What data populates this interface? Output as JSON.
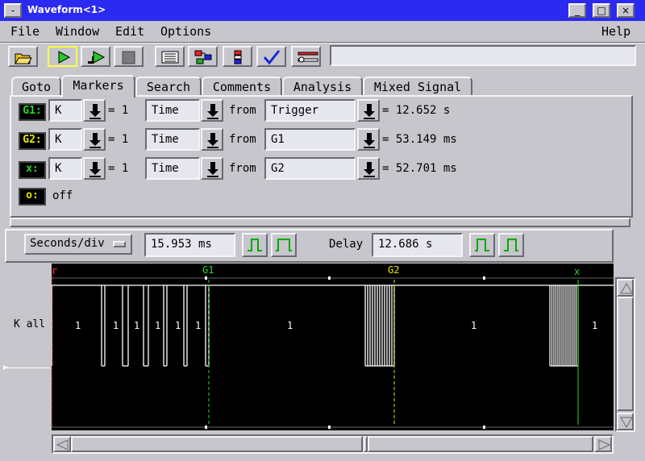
{
  "window": {
    "title": "Waveform<1>",
    "menu_glyph": "-",
    "min_glyph": "_",
    "max_glyph": "□",
    "close_glyph": "×"
  },
  "menu": {
    "file": "File",
    "window": "Window",
    "edit": "Edit",
    "options": "Options",
    "help": "Help"
  },
  "toolbar": {
    "icons": [
      "open-folder-icon",
      "run-single-icon",
      "run-repetitive-icon",
      "stop-icon",
      "listing-icon",
      "overview-icon",
      "config-icon",
      "checkmark-icon",
      "setup-tools-icon"
    ],
    "status_text": ""
  },
  "tabs": [
    "Goto",
    "Markers",
    "Search",
    "Comments",
    "Analysis",
    "Mixed Signal"
  ],
  "active_tab": "Markers",
  "markers": [
    {
      "label": "G1:",
      "color": "#22dd22",
      "label_text_color": "#22dd22",
      "signal": "K",
      "occ_text": "= 1",
      "mode": "Time",
      "from_text": "from",
      "ref": "Trigger",
      "result": "= 12.652 s"
    },
    {
      "label": "G2:",
      "color": "#e8e800",
      "label_text_color": "#e8e800",
      "signal": "K",
      "occ_text": "= 1",
      "mode": "Time",
      "from_text": "from",
      "ref": "G1",
      "result": "= 53.149 ms"
    },
    {
      "label": "x:",
      "color": "#22dd22",
      "label_text_color": "#22dd22",
      "signal": "K",
      "occ_text": "= 1",
      "mode": "Time",
      "from_text": "from",
      "ref": "G2",
      "result": "= 52.701 ms"
    }
  ],
  "o_marker": {
    "label": "o:",
    "color": "#e8e800",
    "state": "off"
  },
  "timebase": {
    "seconds_div_label": "Seconds/div",
    "seconds_div_value": "15.953 ms",
    "delay_label": "Delay",
    "delay_value": "12.686 s"
  },
  "waveform": {
    "signal_label": "K all",
    "marker_labels": {
      "trigger": "r",
      "g1": "G1",
      "g2": "G2",
      "x": "x"
    },
    "value_labels": [
      "1",
      "1",
      "1",
      "1",
      "1",
      "1",
      "1",
      "1",
      "1"
    ],
    "colors": {
      "background": "#000000",
      "trace": "#ffffff",
      "g1": "#22dd22",
      "g2": "#e8e800",
      "x": "#22dd22",
      "trigger": "#ff3333"
    }
  }
}
